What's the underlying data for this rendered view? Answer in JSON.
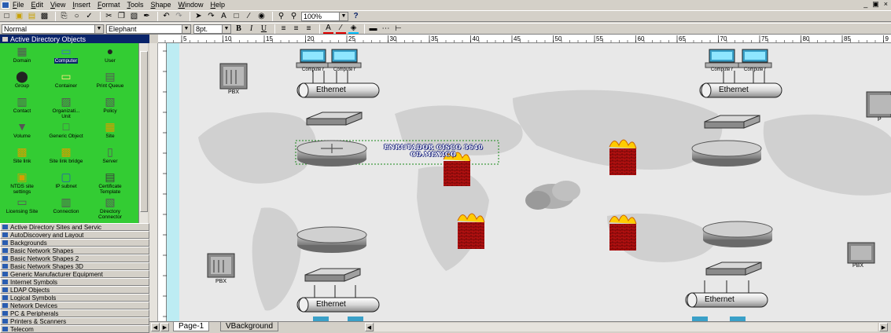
{
  "menu": {
    "items": [
      "File",
      "Edit",
      "View",
      "Insert",
      "Format",
      "Tools",
      "Shape",
      "Window",
      "Help"
    ],
    "window_controls": [
      "_",
      "▣",
      "×"
    ]
  },
  "toolbar": {
    "zoom": "100%",
    "style": "Normal",
    "font": "Elephant",
    "font_size": "8pt.",
    "help": "?"
  },
  "left_panel": {
    "title": "Active Directory Objects",
    "stencils": [
      {
        "label": "Domain",
        "icon": "domain-icon"
      },
      {
        "label": "Computer",
        "icon": "computer-icon",
        "selected": true
      },
      {
        "label": "User",
        "icon": "user-icon"
      },
      {
        "label": "Group",
        "icon": "group-icon"
      },
      {
        "label": "Container",
        "icon": "folder-icon"
      },
      {
        "label": "Print Queue",
        "icon": "printer-icon"
      },
      {
        "label": "Contact",
        "icon": "contact-icon"
      },
      {
        "label": "Organizati... Unit",
        "icon": "ou-icon"
      },
      {
        "label": "Policy",
        "icon": "policy-icon"
      },
      {
        "label": "Volume",
        "icon": "volume-icon"
      },
      {
        "label": "Generic Object",
        "icon": "generic-icon"
      },
      {
        "label": "Site",
        "icon": "site-icon"
      },
      {
        "label": "Site link",
        "icon": "sitelink-icon"
      },
      {
        "label": "Site link bridge",
        "icon": "bridge-icon"
      },
      {
        "label": "Server",
        "icon": "server-icon"
      },
      {
        "label": "NTDS site settings",
        "icon": "ntds-icon"
      },
      {
        "label": "IP subnet",
        "icon": "subnet-icon"
      },
      {
        "label": "Certificate Template",
        "icon": "cert-icon"
      },
      {
        "label": "Licensing Site",
        "icon": "licensing-icon"
      },
      {
        "label": "Connection",
        "icon": "connection-icon"
      },
      {
        "label": "Directory Connector",
        "icon": "connector-icon"
      }
    ],
    "stencil_list": [
      "Active Directory Sites and Servic",
      "AutoDiscovery and Layout",
      "Backgrounds",
      "Basic Network Shapes",
      "Basic Network Shapes 2",
      "Basic Network Shapes 3D",
      "Generic Manufacturer Equipment",
      "Internet Symbols",
      "LDAP Objects",
      "Logical Symbols",
      "Network Devices",
      "PC & Peripherals",
      "Printers & Scanners",
      "Telecom"
    ]
  },
  "ruler": {
    "marks": [
      "5",
      "10",
      "15",
      "20",
      "25",
      "30",
      "35",
      "40",
      "45",
      "50",
      "55",
      "60",
      "65",
      "70",
      "75",
      "80",
      "85",
      "9"
    ]
  },
  "canvas": {
    "router_label_line1": "ENRUTADOR CISCO 3640",
    "router_label_line2": "CD.MEXICO",
    "computer_label": "Compute r",
    "ethernet_label": "Ethernet",
    "pbx_label": "PBX",
    "p_label": "P"
  },
  "tabs": {
    "page1": "Page-1",
    "vbackground": "VBackground"
  },
  "colors": {
    "stencil_bg": "#33cc33",
    "title_bar": "#0a246a",
    "router_text_fill": "#ffffff"
  }
}
